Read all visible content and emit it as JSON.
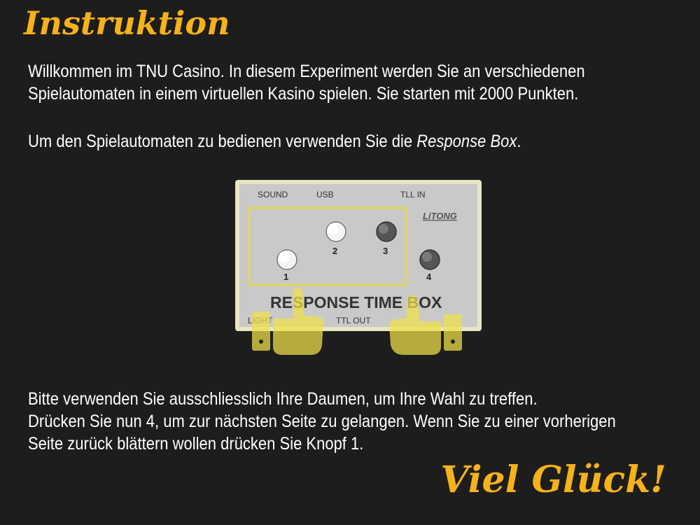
{
  "title": "Instruktion",
  "intro": {
    "line1": "Willkommen im TNU Casino. In diesem Experiment werden Sie an verschiedenen",
    "line2": "Spielautomaten in einem virtuellen Kasino spielen. Sie starten mit 2000 Punkten."
  },
  "usage": {
    "prefix": "Um den Spielautomaten zu bedienen verwenden Sie die ",
    "device": "Response Box",
    "suffix": "."
  },
  "response_box": {
    "labels": {
      "sound": "SOUND",
      "usb": "USB",
      "ttl_in": "TLL IN",
      "light": "LIGHT",
      "ttl_out": "TTL OUT",
      "brand": "LiTONG",
      "name": "RESPONSE TIME BOX"
    },
    "buttons": [
      {
        "number": "1",
        "state": "lit"
      },
      {
        "number": "2",
        "state": "lit"
      },
      {
        "number": "3",
        "state": "dark"
      },
      {
        "number": "4",
        "state": "dark"
      }
    ],
    "colors": {
      "panel": "#c9c9c9",
      "frame": "#e8e6c2",
      "thumb": "#f0e34a"
    }
  },
  "instructions": {
    "line1": "Bitte verwenden Sie ausschliesslich Ihre Daumen, um Ihre Wahl zu treffen.",
    "line2": "Drücken Sie nun 4, um zur nächsten Seite zu gelangen. Wenn Sie zu einer vorherigen",
    "line3": "Seite zurück blättern wollen drücken Sie Knopf 1."
  },
  "closing": "Viel Glück!",
  "colors": {
    "background": "#1e1d1d",
    "accent": "#f5b219",
    "text": "#ffffff"
  }
}
